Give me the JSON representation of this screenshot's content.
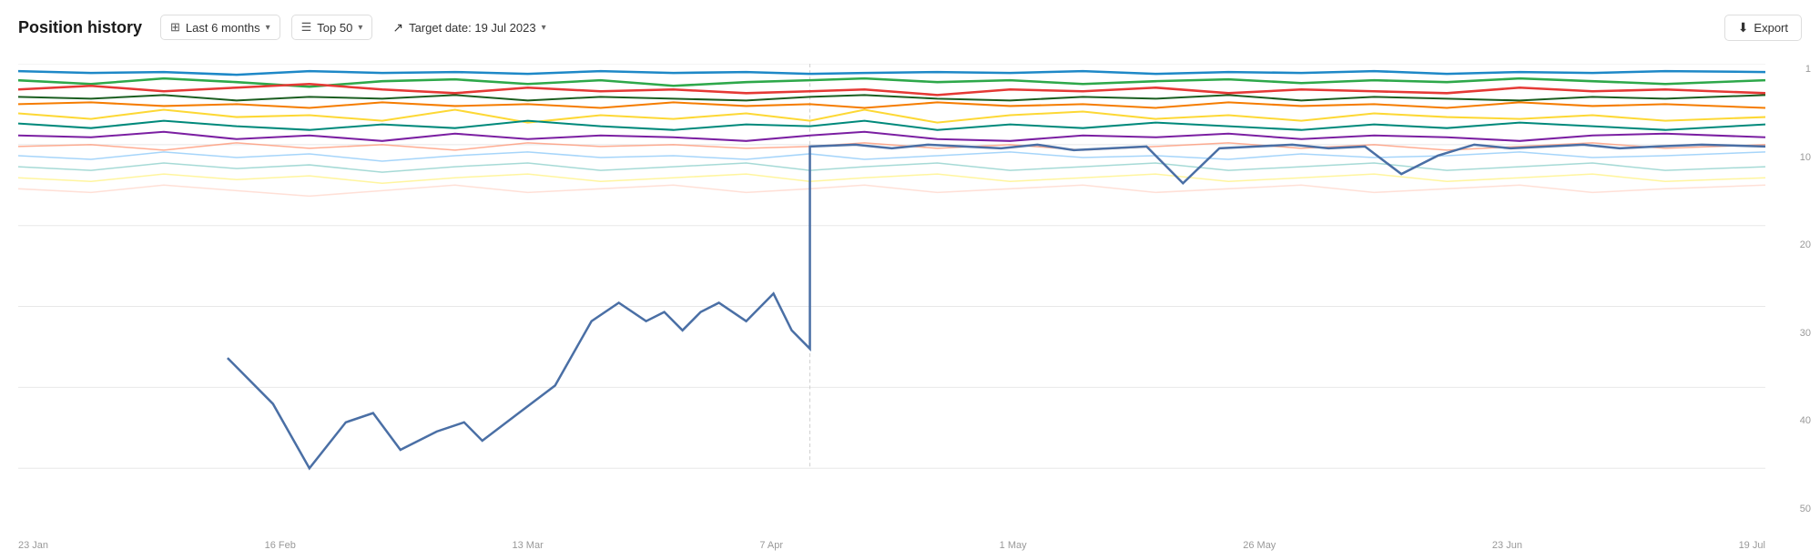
{
  "header": {
    "title": "Position history",
    "controls": {
      "period_label": "Last 6 months",
      "period_icon": "calendar-icon",
      "top_label": "Top 50",
      "top_icon": "list-icon",
      "target_label": "Target date: 19 Jul 2023",
      "target_icon": "trend-icon"
    },
    "export_label": "Export",
    "export_icon": "export-icon"
  },
  "chart": {
    "x_labels": [
      "23 Jan",
      "16 Feb",
      "13 Mar",
      "7 Apr",
      "1 May",
      "26 May",
      "23 Jun",
      "19 Jul"
    ],
    "y_labels": [
      "1",
      "10",
      "20",
      "30",
      "40",
      "50"
    ],
    "colors": {
      "accent": "#4a7fa5",
      "grid": "#f0f0f0"
    }
  }
}
